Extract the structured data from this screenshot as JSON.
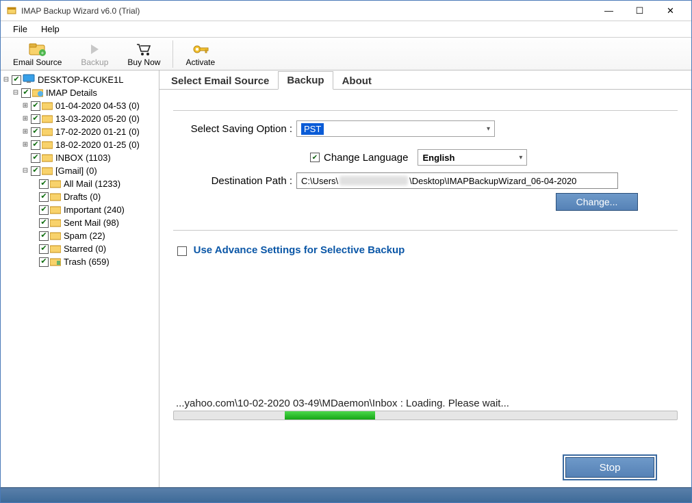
{
  "window": {
    "title": "IMAP Backup Wizard v6.0 (Trial)"
  },
  "menubar": {
    "file": "File",
    "help": "Help"
  },
  "toolbar": {
    "email_source": "Email Source",
    "backup": "Backup",
    "buy_now": "Buy Now",
    "activate": "Activate"
  },
  "tree": {
    "root": "DESKTOP-KCUKE1L",
    "imap_details": "IMAP Details",
    "dated": [
      "01-04-2020 04-53 (0)",
      "13-03-2020 05-20 (0)",
      "17-02-2020 01-21 (0)",
      "18-02-2020 01-25 (0)"
    ],
    "inbox": "INBOX (1103)",
    "gmail": "[Gmail] (0)",
    "gmail_children": [
      "All Mail (1233)",
      "Drafts (0)",
      "Important (240)",
      "Sent Mail (98)",
      "Spam (22)",
      "Starred (0)",
      "Trash (659)"
    ]
  },
  "tabs": {
    "select_email_source": "Select Email Source",
    "backup": "Backup",
    "about": "About"
  },
  "form": {
    "saving_option_label": "Select Saving Option :",
    "saving_option_value": "PST",
    "change_language_label": "Change Language",
    "language_value": "English",
    "destination_label": "Destination Path :",
    "destination_prefix": "C:\\Users\\",
    "destination_suffix": "\\Desktop\\IMAPBackupWizard_06-04-2020",
    "change_btn": "Change...",
    "advance_label": "Use Advance Settings for Selective Backup",
    "status": "...yahoo.com\\10-02-2020 03-49\\MDaemon\\Inbox : Loading. Please wait...",
    "stop": "Stop"
  }
}
